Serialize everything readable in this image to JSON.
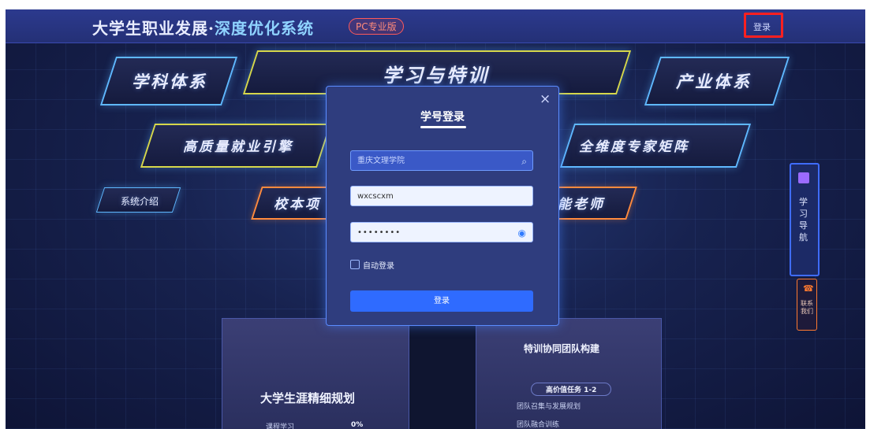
{
  "header": {
    "title_main": "大学生职业发展",
    "title_sep": "·",
    "title_accent": "深度优化系统",
    "badge": "PC专业版",
    "login_link": "登录"
  },
  "panels": {
    "subject": "学科体系",
    "study": "学习与特训",
    "industry": "产业体系",
    "employment": "高质量就业引擎",
    "expert": "全维度专家矩阵",
    "intro": "系统介绍",
    "campus": "校本项",
    "teacher": "能老师"
  },
  "side_nav": {
    "label": "学习导航"
  },
  "contact": {
    "label": "联系我们"
  },
  "cards": {
    "planning": "大学生涯精细规划",
    "progress_label": "课程学习",
    "progress_value": "0%",
    "team": "特训协同团队构建",
    "task": "高价值任务 1-2",
    "item1": "团队召集与发展规划",
    "item2": "团队融合训练"
  },
  "login_modal": {
    "title": "学号登录",
    "close": "×",
    "school_value": "重庆文理学院",
    "username_value": "wxcscxm",
    "password_mask": "••••••••",
    "auto_login": "自动登录",
    "submit": "登录"
  },
  "colors": {
    "accent": "#2f6bff",
    "highlight": "#ff2020"
  }
}
